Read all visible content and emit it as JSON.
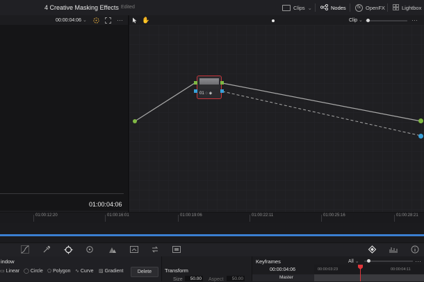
{
  "header": {
    "project_title": "4 Creative Masking Effects",
    "status": "Edited",
    "clips_label": "Clips",
    "nodes_label": "Nodes",
    "openfx_label": "OpenFX",
    "lightbox_label": "Lightbox"
  },
  "viewer": {
    "timecode_top": "00:00:04:06",
    "timecode_display": "01:00:04:06",
    "menu_label": "···"
  },
  "node_editor": {
    "mode_label": "Clip",
    "menu_label": "···",
    "node_label": "01"
  },
  "timeline": {
    "ticks": [
      "01:00:12:20",
      "01:00:16:01",
      "01:00:19:06",
      "01:00:22:11",
      "01:00:25:16",
      "01:00:28:21"
    ]
  },
  "window_panel": {
    "title": "indow",
    "tools": [
      "Linear",
      "Circle",
      "Polygon",
      "Curve",
      "Gradient"
    ],
    "delete_label": "Delete"
  },
  "transform_panel": {
    "title": "Transform",
    "size_label": "Size",
    "size_value": "50.00",
    "aspect_label": "Aspect",
    "aspect_value": "50.00"
  },
  "keyframes_panel": {
    "title": "Keyframes",
    "filter_label": "All",
    "menu_label": "···",
    "timecode": "00:00:04:06",
    "ruler_start": "00:00:03:23",
    "ruler_end": "00:00:04:11",
    "track_label": "Master"
  },
  "colors": {
    "accent_blue": "#3b7fd2",
    "playhead_red": "#e0353a",
    "node_border": "#c9363c",
    "input_green": "#7fb843",
    "input_blue": "#3aa0d8"
  }
}
